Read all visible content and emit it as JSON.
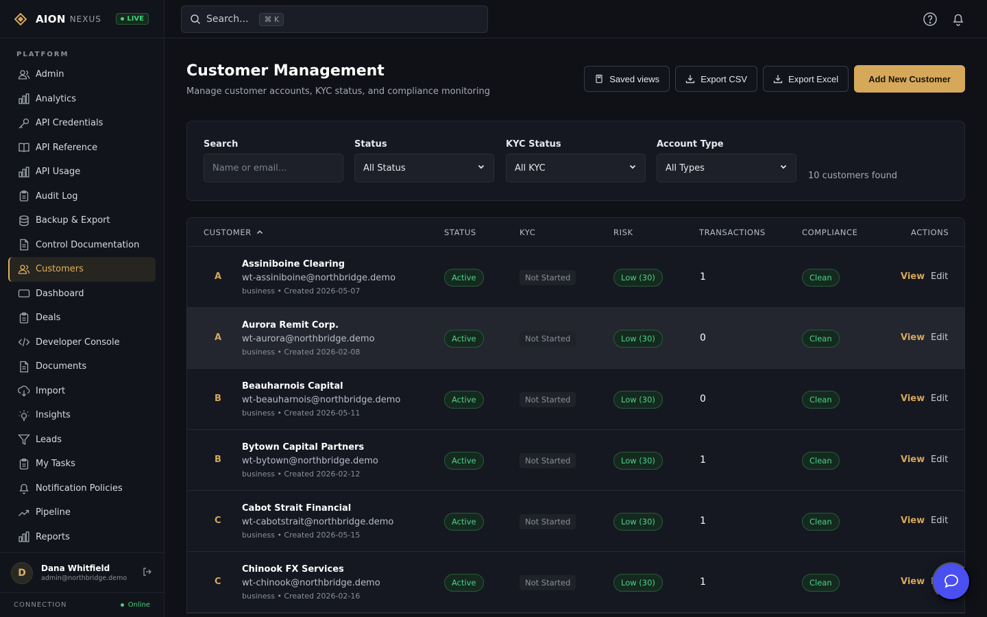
{
  "brand": {
    "name": "AION",
    "sub": "NEXUS",
    "live": "LIVE"
  },
  "sidebar": {
    "section": "PLATFORM",
    "items": [
      {
        "label": "Admin",
        "icon": "users-icon"
      },
      {
        "label": "Analytics",
        "icon": "bar-chart-icon"
      },
      {
        "label": "API Credentials",
        "icon": "key-icon"
      },
      {
        "label": "API Reference",
        "icon": "book-icon"
      },
      {
        "label": "API Usage",
        "icon": "bar-chart-icon"
      },
      {
        "label": "Audit Log",
        "icon": "clipboard-icon"
      },
      {
        "label": "Backup & Export",
        "icon": "database-icon"
      },
      {
        "label": "Control Documentation",
        "icon": "document-icon"
      },
      {
        "label": "Customers",
        "icon": "users-icon",
        "active": true
      },
      {
        "label": "Dashboard",
        "icon": "rectangle-icon"
      },
      {
        "label": "Deals",
        "icon": "clipboard-icon"
      },
      {
        "label": "Developer Console",
        "icon": "code-icon"
      },
      {
        "label": "Documents",
        "icon": "document-icon"
      },
      {
        "label": "Import",
        "icon": "import-icon"
      },
      {
        "label": "Insights",
        "icon": "lightbulb-icon"
      },
      {
        "label": "Leads",
        "icon": "filter-icon"
      },
      {
        "label": "My Tasks",
        "icon": "clipboard-icon"
      },
      {
        "label": "Notification Policies",
        "icon": "bell-icon"
      },
      {
        "label": "Pipeline",
        "icon": "trend-icon"
      },
      {
        "label": "Reports",
        "icon": "bar-chart-icon"
      }
    ]
  },
  "user": {
    "initial": "D",
    "name": "Dana Whitfield",
    "email": "admin@northbridge.demo"
  },
  "connection": {
    "label": "CONNECTION",
    "status": "Online"
  },
  "topbar": {
    "search_placeholder": "Search...",
    "shortcut": "⌘ K"
  },
  "page": {
    "title": "Customer Management",
    "subtitle": "Manage customer accounts, KYC status, and compliance monitoring",
    "buttons": {
      "saved_views": "Saved views",
      "export_csv": "Export CSV",
      "export_excel": "Export Excel",
      "add": "Add New Customer"
    }
  },
  "filters": {
    "search_label": "Search",
    "search_placeholder": "Name or email...",
    "status_label": "Status",
    "status_value": "All Status",
    "kyc_label": "KYC Status",
    "kyc_value": "All KYC",
    "type_label": "Account Type",
    "type_value": "All Types",
    "found": "10 customers found"
  },
  "table": {
    "headers": {
      "customer": "CUSTOMER",
      "status": "STATUS",
      "kyc": "KYC",
      "risk": "RISK",
      "transactions": "TRANSACTIONS",
      "compliance": "COMPLIANCE",
      "actions": "ACTIONS"
    },
    "view_label": "View",
    "edit_label": "Edit",
    "rows": [
      {
        "initial": "A",
        "name": "Assiniboine Clearing",
        "email": "wt-assiniboine@northbridge.demo",
        "meta": "business • Created 2026-05-07",
        "status": "Active",
        "kyc": "Not Started",
        "risk": "Low (30)",
        "transactions": "1",
        "compliance": "Clean"
      },
      {
        "initial": "A",
        "name": "Aurora Remit Corp.",
        "email": "wt-aurora@northbridge.demo",
        "meta": "business • Created 2026-02-08",
        "status": "Active",
        "kyc": "Not Started",
        "risk": "Low (30)",
        "transactions": "0",
        "compliance": "Clean"
      },
      {
        "initial": "B",
        "name": "Beauharnois Capital",
        "email": "wt-beauharnois@northbridge.demo",
        "meta": "business • Created 2026-05-11",
        "status": "Active",
        "kyc": "Not Started",
        "risk": "Low (30)",
        "transactions": "0",
        "compliance": "Clean"
      },
      {
        "initial": "B",
        "name": "Bytown Capital Partners",
        "email": "wt-bytown@northbridge.demo",
        "meta": "business • Created 2026-02-12",
        "status": "Active",
        "kyc": "Not Started",
        "risk": "Low (30)",
        "transactions": "1",
        "compliance": "Clean"
      },
      {
        "initial": "C",
        "name": "Cabot Strait Financial",
        "email": "wt-cabotstrait@northbridge.demo",
        "meta": "business • Created 2026-05-15",
        "status": "Active",
        "kyc": "Not Started",
        "risk": "Low (30)",
        "transactions": "1",
        "compliance": "Clean"
      },
      {
        "initial": "C",
        "name": "Chinook FX Services",
        "email": "wt-chinook@northbridge.demo",
        "meta": "business • Created 2026-02-16",
        "status": "Active",
        "kyc": "Not Started",
        "risk": "Low (30)",
        "transactions": "1",
        "compliance": "Clean"
      }
    ]
  },
  "colors": {
    "accent": "#d6a85a",
    "success": "#4fd08a",
    "fab": "#4a4ff0"
  }
}
